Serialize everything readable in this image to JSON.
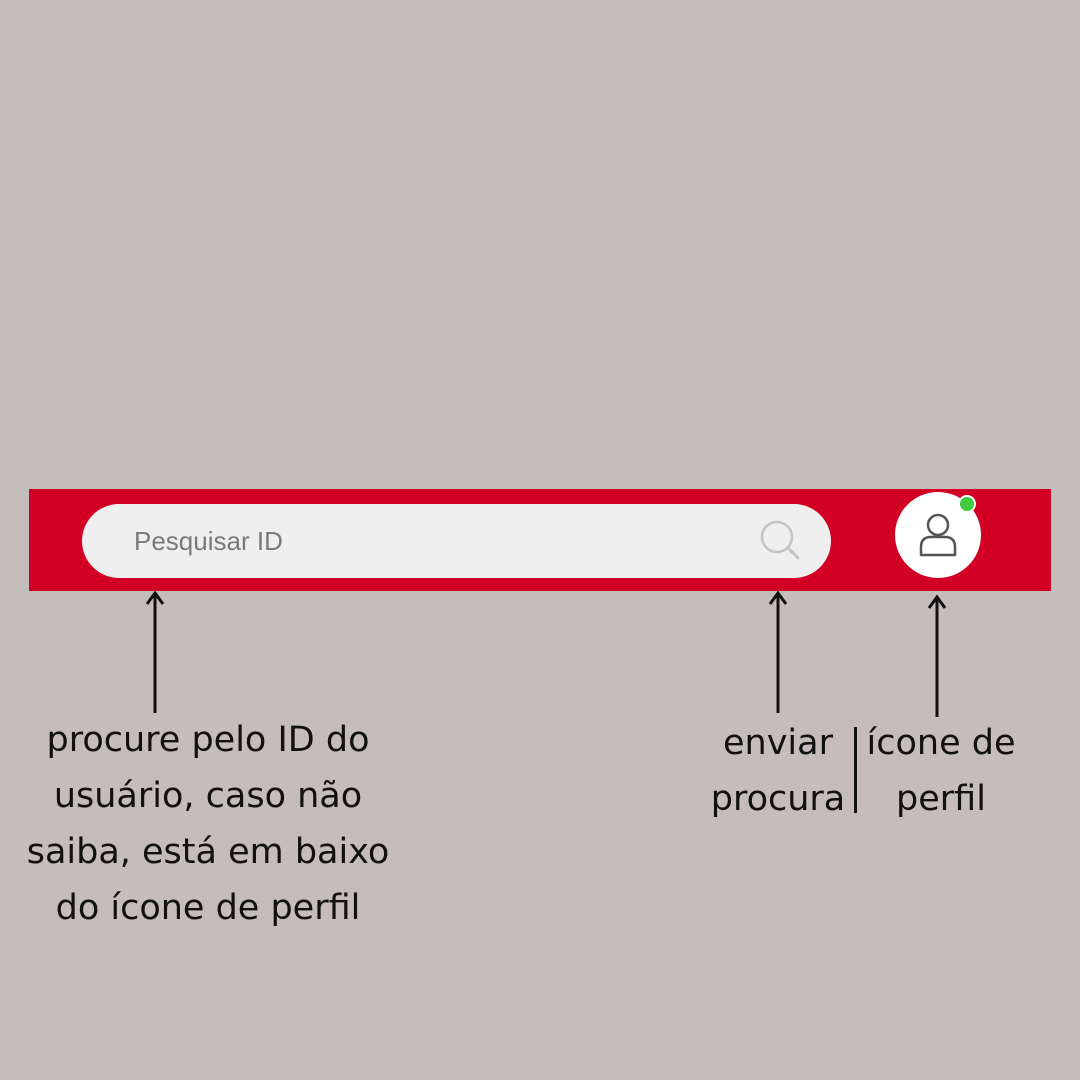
{
  "colors": {
    "background": "#c5bdbc",
    "topbar": "#d20025",
    "search_field": "#efefef",
    "status_online": "#3ecb3e"
  },
  "topbar": {
    "search": {
      "placeholder": "Pesquisar ID",
      "value": "",
      "submit_icon": "search-icon"
    },
    "profile": {
      "icon": "user-icon",
      "status": "online"
    }
  },
  "annotations": {
    "search_field_caption": "procure pelo ID do usuário, caso não saiba, está em baixo do ícone de perfil",
    "search_button_caption": "enviar procura",
    "profile_icon_caption": "ícone de perfil"
  }
}
